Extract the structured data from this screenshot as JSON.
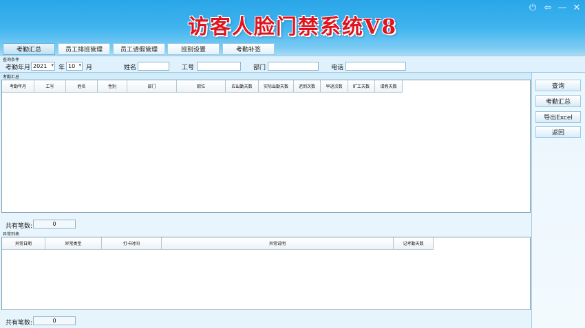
{
  "app": {
    "title": "访客人脸门禁系统V8"
  },
  "nav": {
    "tabs": [
      {
        "label": "考勤汇总"
      },
      {
        "label": "员工排班管理"
      },
      {
        "label": "员工请假管理"
      },
      {
        "label": "班别设置"
      },
      {
        "label": "考勤补签"
      }
    ]
  },
  "query": {
    "caption": "查询条件",
    "year_month_label": "考勤年月",
    "year_value": "2021",
    "year_unit": "年",
    "month_value": "10",
    "month_unit": "月",
    "name_label": "姓名",
    "id_label": "工号",
    "dept_label": "部门",
    "phone_label": "电话"
  },
  "summary": {
    "caption": "考勤汇总",
    "columns": [
      "考勤年月",
      "工号",
      "姓名",
      "性别",
      "部门",
      "职位",
      "应出勤天数",
      "实际出勤天数",
      "迟到次数",
      "早退次数",
      "旷工天数",
      "请假天数"
    ],
    "count_label": "共有笔数:",
    "count_value": "0"
  },
  "exceptions": {
    "caption": "异常列表",
    "columns": [
      "异常日期",
      "异常类型",
      "打卡时间",
      "异常说明",
      "记考勤天数"
    ],
    "count_label": "共有笔数:",
    "count_value": "0"
  },
  "sidebar": {
    "query_label": "查询",
    "summary_label": "考勤汇总",
    "export_label": "导出Excel",
    "back_label": "返回"
  },
  "window_controls": {
    "power": "⏻",
    "back": "⇦",
    "minimize": "—",
    "close": "✕"
  },
  "colors": {
    "title": "#e0141e",
    "header_blue": "#2aa6e8"
  }
}
